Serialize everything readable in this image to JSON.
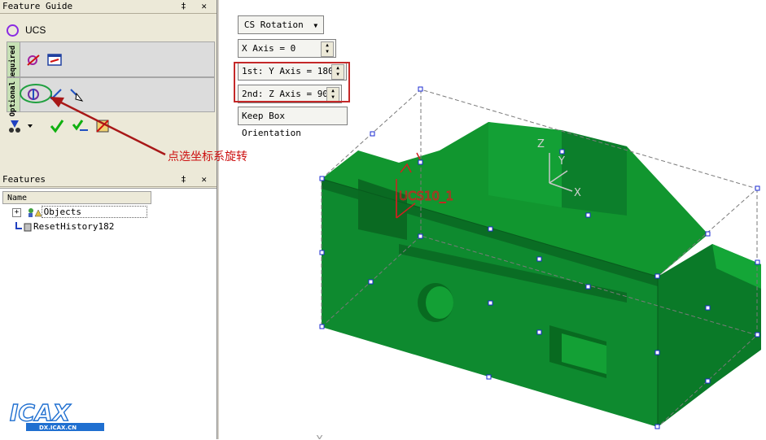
{
  "feature_guide": {
    "title": "Feature Guide",
    "pin_close": "‡ ✕",
    "ucs_label": "UCS",
    "required_tab": "Required",
    "optional_tab": "Optional"
  },
  "features_panel": {
    "title": "Features",
    "pin_close": "‡ ✕",
    "column_name": "Name",
    "items": [
      {
        "label": "Objects"
      },
      {
        "label": "ResetHistory182"
      }
    ]
  },
  "controls": {
    "cs_rotation": "CS Rotation",
    "x_axis": "X Axis = 0",
    "y_axis": "1st: Y Axis = 180",
    "z_axis": "2nd: Z Axis = 90",
    "keep_box": "Keep Box Orientation"
  },
  "annotation": {
    "text": "点选坐标系旋转"
  },
  "viewport": {
    "ucs_name": "UCS10_1",
    "axis_z": "Z",
    "axis_y": "Y",
    "axis_x": "X",
    "bottom_x": "X",
    "model_color": "#0d8a2e"
  },
  "logo": {
    "text": "ICAX",
    "url": "DX.ICAX.CN"
  }
}
